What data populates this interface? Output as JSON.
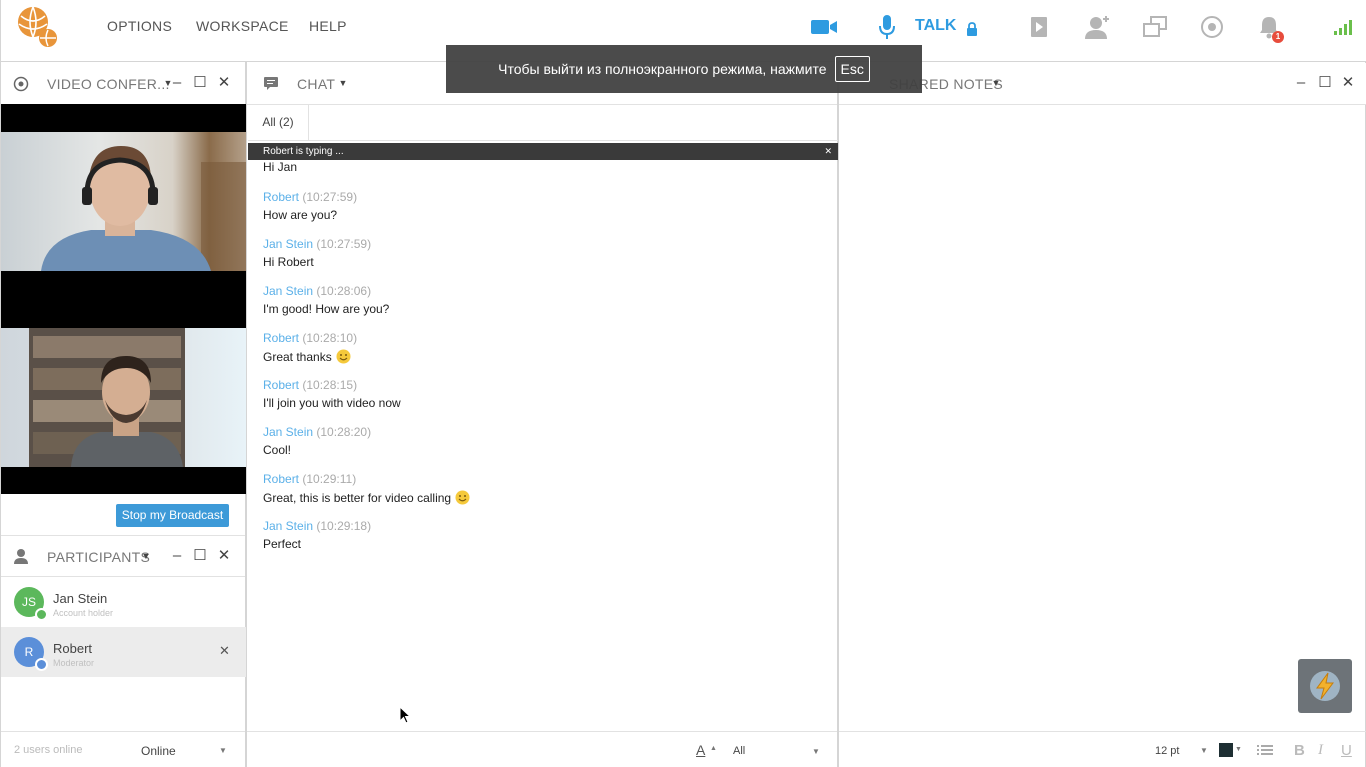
{
  "topbar": {
    "menu": [
      "OPTIONS",
      "WORKSPACE",
      "HELP"
    ],
    "talk_label": "TALK",
    "notification_count": "1",
    "icons": [
      "video-camera-icon",
      "microphone-icon",
      "lock-icon",
      "presentation-icon",
      "add-user-icon",
      "screenshare-icon",
      "record-icon",
      "bell-icon",
      "signal-icon"
    ],
    "accent_color": "#2e9be0"
  },
  "toast": {
    "text": "Чтобы выйти из полноэкранного режима, нажмите",
    "key": "Esc"
  },
  "video_panel": {
    "title": "VIDEO CONFER...",
    "broadcast_button": "Stop my Broadcast"
  },
  "participants_panel": {
    "title": "PARTICIPANTS",
    "items": [
      {
        "initials": "JS",
        "name": "Jan Stein",
        "role": "Account holder",
        "color": "#5cb85c"
      },
      {
        "initials": "R",
        "name": "Robert",
        "role": "Moderator",
        "color": "#5b8fd9"
      }
    ],
    "footer_count": "2 users online",
    "footer_status": "Online"
  },
  "chat_panel": {
    "title": "CHAT",
    "tab_all": "All (2)",
    "typing": "Robert is typing ...",
    "first_line": "Hi Jan",
    "messages": [
      {
        "name": "Robert",
        "time": "(10:27:59)",
        "text": "How are you?",
        "emoji": false
      },
      {
        "name": "Jan Stein",
        "time": "(10:27:59)",
        "text": "Hi Robert",
        "emoji": false
      },
      {
        "name": "Jan Stein",
        "time": "(10:28:06)",
        "text": "I'm good! How are you?",
        "emoji": false
      },
      {
        "name": "Robert",
        "time": "(10:28:10)",
        "text": "Great thanks",
        "emoji": true
      },
      {
        "name": "Robert",
        "time": "(10:28:15)",
        "text": "I'll join you with video now",
        "emoji": false
      },
      {
        "name": "Jan Stein",
        "time": "(10:28:20)",
        "text": "Cool!",
        "emoji": false
      },
      {
        "name": "Robert",
        "time": "(10:29:11)",
        "text": "Great, this is better for video calling",
        "emoji": true
      },
      {
        "name": "Jan Stein",
        "time": "(10:29:18)",
        "text": "Perfect",
        "emoji": false
      }
    ],
    "footer_select": "All"
  },
  "notes_panel": {
    "title": "SHARED NOTES",
    "font_size": "12 pt",
    "format_b": "B",
    "format_i": "I",
    "format_u": "U"
  }
}
